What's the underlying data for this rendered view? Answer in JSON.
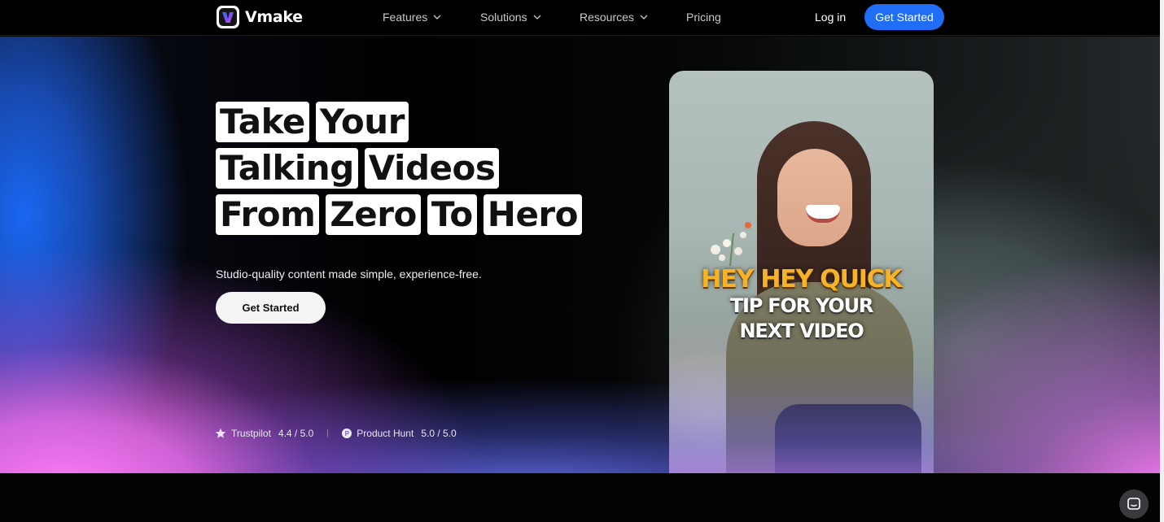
{
  "brand": {
    "name": "Vmake",
    "accent": "#1f6ef5"
  },
  "nav": {
    "items": [
      {
        "label": "Features",
        "has_dropdown": true
      },
      {
        "label": "Solutions",
        "has_dropdown": true
      },
      {
        "label": "Resources",
        "has_dropdown": true
      },
      {
        "label": "Pricing",
        "has_dropdown": false
      }
    ],
    "login_label": "Log in",
    "cta_label": "Get Started"
  },
  "hero": {
    "headline_rows": [
      [
        "Take",
        "Your"
      ],
      [
        "Talking",
        "Videos"
      ],
      [
        "From",
        "Zero",
        "To",
        "Hero"
      ]
    ],
    "subtitle": "Studio-quality content made simple, experience-free.",
    "cta_label": "Get Started",
    "ratings": [
      {
        "icon": "star-icon",
        "source": "Trustpilot",
        "score": "4.4 / 5.0"
      },
      {
        "icon": "product-hunt-icon",
        "source": "Product Hunt",
        "score": "5.0 / 5.0"
      }
    ],
    "video_caption": {
      "line1": "HEY HEY QUICK",
      "line2": "TIP FOR YOUR",
      "line3": "NEXT VIDEO"
    }
  },
  "widgets": {
    "chat_icon": "chat-icon"
  }
}
